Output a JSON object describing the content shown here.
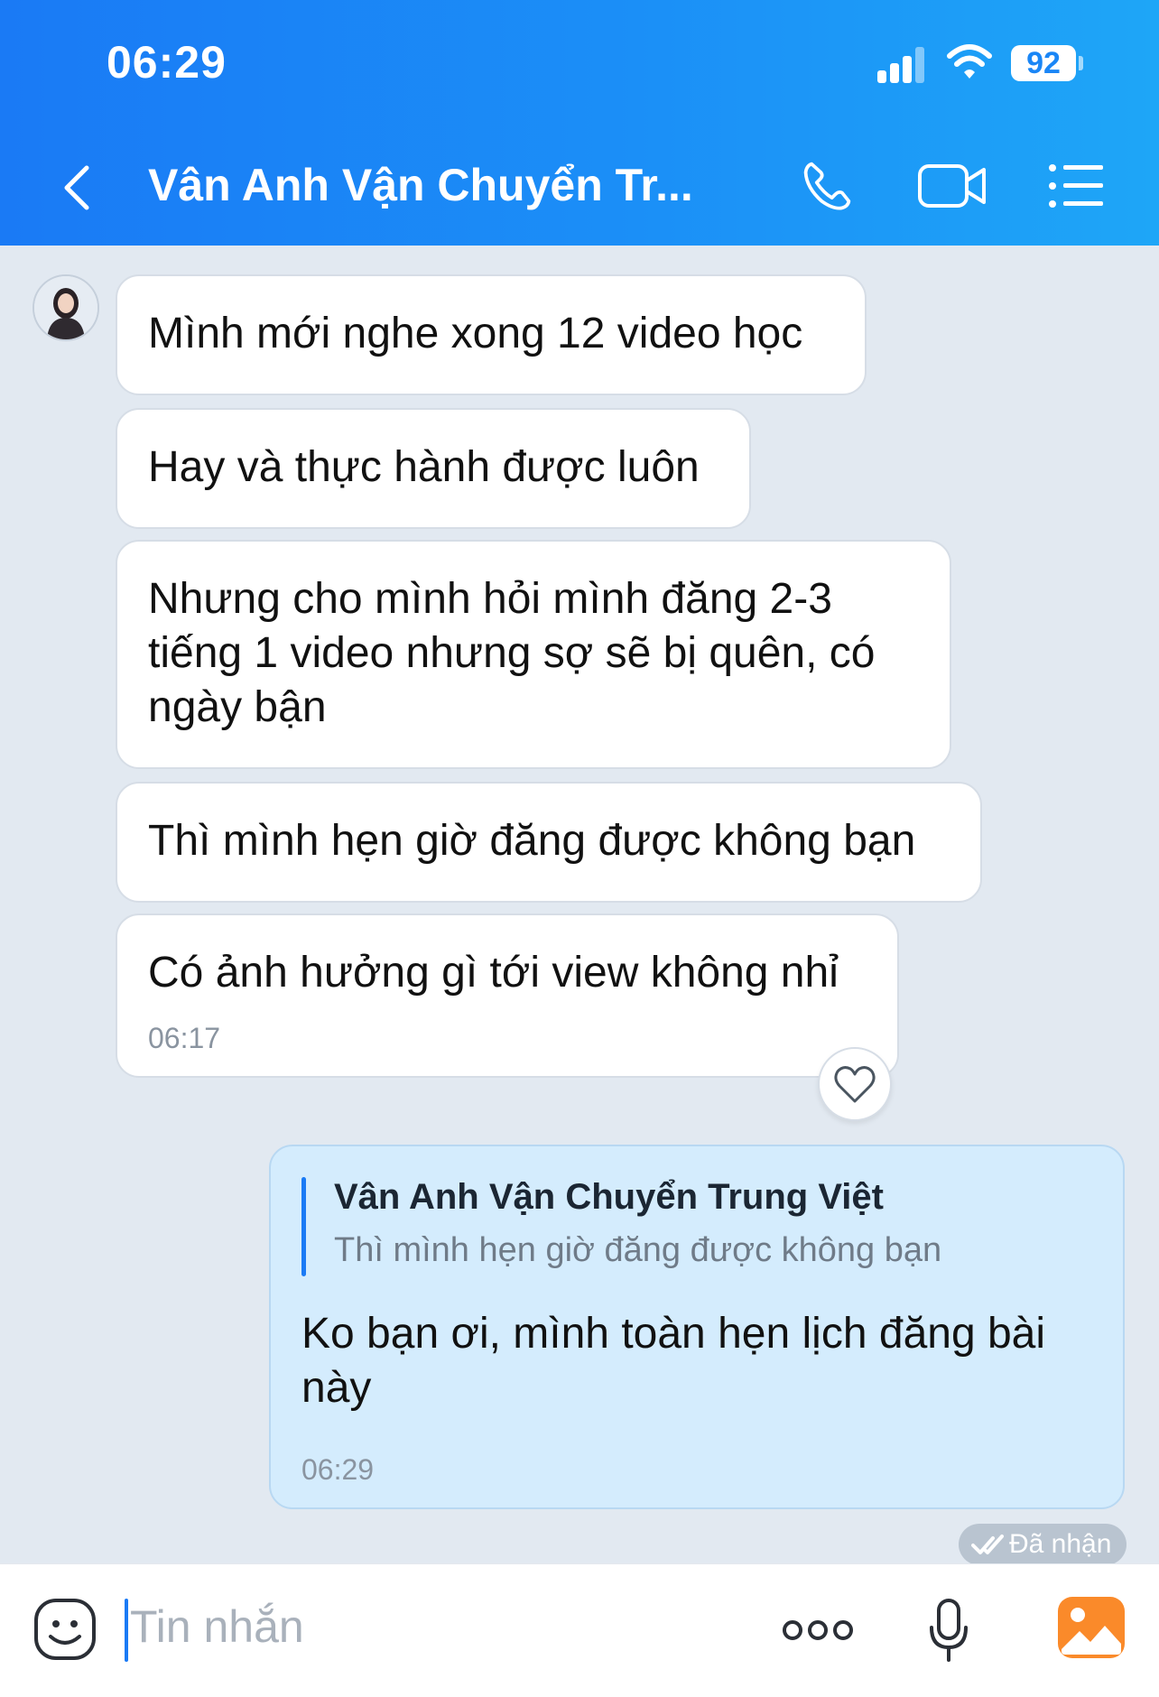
{
  "status_bar": {
    "time": "06:29",
    "battery": "92"
  },
  "header": {
    "title": "Vân Anh Vận Chuyển Tr..."
  },
  "messages": [
    {
      "text": "Mình mới nghe xong 12 video học"
    },
    {
      "text": "Hay và thực hành được luôn"
    },
    {
      "text": "Nhưng cho mình hỏi mình đăng 2-3 tiếng 1 video nhưng sợ sẽ bị quên, có ngày bận"
    },
    {
      "text": "Thì mình hẹn giờ đăng được không bạn"
    },
    {
      "text": "Có ảnh hưởng gì tới view không nhỉ",
      "time": "06:17"
    }
  ],
  "reply": {
    "quoted_name": "Vân Anh Vận Chuyển Trung Việt",
    "quoted_text": "Thì mình hẹn giờ đăng được không bạn",
    "text": "Ko bạn ơi, mình toàn hẹn lịch đăng bài này",
    "time": "06:29",
    "status": "Đã nhận"
  },
  "composer": {
    "placeholder": "Tin nhắn"
  },
  "icons": [
    "back-arrow-icon",
    "phone-icon",
    "video-call-icon",
    "menu-list-icon",
    "heart-icon",
    "double-check-icon",
    "emoji-icon",
    "more-icon",
    "microphone-icon",
    "gallery-icon"
  ],
  "colors": {
    "accent": "#1a7af5",
    "sent_bubble": "#d4ecfd",
    "background": "#e2e9f1"
  }
}
